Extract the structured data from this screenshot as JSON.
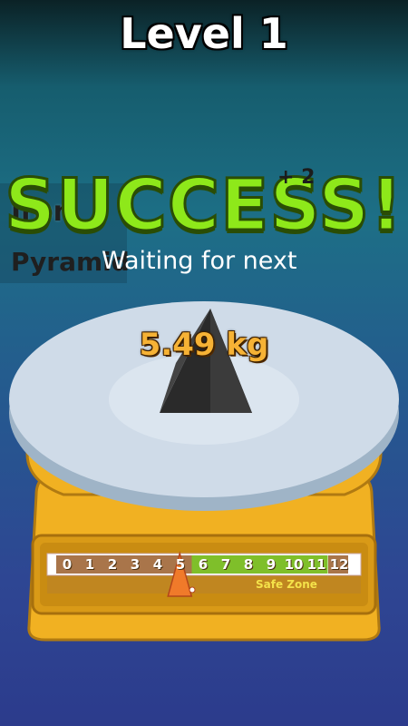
{
  "header": {
    "level_title": "Level 1"
  },
  "item": {
    "material": "Iron",
    "shape": "Pyramid",
    "status_text": "Waiting for next"
  },
  "result": {
    "banner": "SUCCESS!",
    "bonus": "+ 2"
  },
  "scale": {
    "readout": "5.49 kg",
    "needle_value": 5.49,
    "gauge_ticks": [
      "0",
      "1",
      "2",
      "3",
      "4",
      "5",
      "6",
      "7",
      "8",
      "9",
      "10",
      "11",
      "12"
    ],
    "safe_zone": {
      "label": "Safe Zone",
      "from": 6,
      "to": 11
    }
  },
  "colors": {
    "success": "#8ee81a",
    "readout": "#f6b235",
    "scale_body": "#f1b122",
    "platform": "#c9d7e6",
    "safe_zone": "#7fbf2a",
    "needle": "#f07a2a"
  }
}
